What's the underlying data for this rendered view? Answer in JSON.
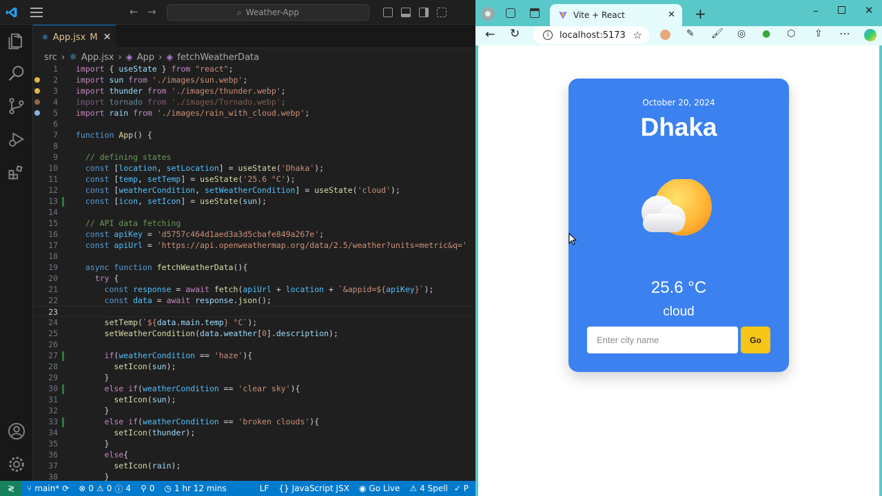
{
  "vscode": {
    "search": "Weather-App",
    "tab": {
      "name": "App.jsx",
      "modified": "M"
    },
    "breadcrumb": [
      "src",
      "App.jsx",
      "App",
      "fetchWeatherData"
    ],
    "lines": [
      {
        "n": "1",
        "t": [
          [
            "kw2",
            "import"
          ],
          [
            "op",
            " { "
          ],
          [
            "var",
            "useState"
          ],
          [
            "op",
            " } "
          ],
          [
            "kw2",
            "from"
          ],
          [
            "str",
            " \"react\""
          ],
          [
            "op",
            ";"
          ]
        ]
      },
      {
        "n": "2",
        "t": [
          [
            "kw2",
            "import"
          ],
          [
            "var",
            " sun "
          ],
          [
            "kw2",
            "from"
          ],
          [
            "str",
            " './images/sun.webp'"
          ],
          [
            "op",
            ";"
          ]
        ]
      },
      {
        "n": "3",
        "t": [
          [
            "kw2",
            "import"
          ],
          [
            "var",
            " thunder "
          ],
          [
            "kw2",
            "from"
          ],
          [
            "str",
            " './images/thunder.webp'"
          ],
          [
            "op",
            ";"
          ]
        ]
      },
      {
        "n": "4",
        "dim": true,
        "t": [
          [
            "kw2",
            "import"
          ],
          [
            "var",
            " tornado "
          ],
          [
            "kw2",
            "from"
          ],
          [
            "str",
            " './images/Tornado.webp'"
          ],
          [
            "op",
            ";"
          ]
        ]
      },
      {
        "n": "5",
        "t": [
          [
            "kw2",
            "import"
          ],
          [
            "var",
            " rain "
          ],
          [
            "kw2",
            "from"
          ],
          [
            "str",
            " './images/rain_with_cloud.webp'"
          ],
          [
            "op",
            ";"
          ]
        ]
      },
      {
        "n": "6",
        "t": []
      },
      {
        "n": "7",
        "t": [
          [
            "kw",
            "function"
          ],
          [
            "fn",
            " App"
          ],
          [
            "op",
            "() {"
          ]
        ]
      },
      {
        "n": "8",
        "t": []
      },
      {
        "n": "9",
        "t": [
          [
            "cm",
            "  // defining states"
          ]
        ]
      },
      {
        "n": "10",
        "t": [
          [
            "kw",
            "  const"
          ],
          [
            "op",
            " ["
          ],
          [
            "cn",
            "location"
          ],
          [
            "op",
            ", "
          ],
          [
            "cn",
            "setLocation"
          ],
          [
            "op",
            "] = "
          ],
          [
            "fn",
            "useState"
          ],
          [
            "op",
            "("
          ],
          [
            "str",
            "'Dhaka'"
          ],
          [
            "op",
            ");"
          ]
        ]
      },
      {
        "n": "11",
        "t": [
          [
            "kw",
            "  const"
          ],
          [
            "op",
            " ["
          ],
          [
            "cn",
            "temp"
          ],
          [
            "op",
            ", "
          ],
          [
            "cn",
            "setTemp"
          ],
          [
            "op",
            "] = "
          ],
          [
            "fn",
            "useState"
          ],
          [
            "op",
            "("
          ],
          [
            "str",
            "'25.6 °C'"
          ],
          [
            "op",
            ");"
          ]
        ]
      },
      {
        "n": "12",
        "t": [
          [
            "kw",
            "  const"
          ],
          [
            "op",
            " ["
          ],
          [
            "cn",
            "weatherCondition"
          ],
          [
            "op",
            ", "
          ],
          [
            "cn",
            "setWeatherCondition"
          ],
          [
            "op",
            "] = "
          ],
          [
            "fn",
            "useState"
          ],
          [
            "op",
            "("
          ],
          [
            "str",
            "'cloud'"
          ],
          [
            "op",
            ");"
          ]
        ]
      },
      {
        "n": "13",
        "t": [
          [
            "kw",
            "  const"
          ],
          [
            "op",
            " ["
          ],
          [
            "cn",
            "icon"
          ],
          [
            "op",
            ", "
          ],
          [
            "cn",
            "setIcon"
          ],
          [
            "op",
            "] = "
          ],
          [
            "fn",
            "useState"
          ],
          [
            "op",
            "("
          ],
          [
            "var",
            "sun"
          ],
          [
            "op",
            ");"
          ]
        ]
      },
      {
        "n": "14",
        "t": []
      },
      {
        "n": "15",
        "t": [
          [
            "cm",
            "  // API data fetching"
          ]
        ]
      },
      {
        "n": "16",
        "t": [
          [
            "kw",
            "  const"
          ],
          [
            "cn",
            " apiKey"
          ],
          [
            "op",
            " = "
          ],
          [
            "str",
            "'d5757c464d1aed3a3d5cbafe849a267e'"
          ],
          [
            "op",
            ";"
          ]
        ]
      },
      {
        "n": "17",
        "t": [
          [
            "kw",
            "  const"
          ],
          [
            "cn",
            " apiUrl"
          ],
          [
            "op",
            " = "
          ],
          [
            "str",
            "'https://api.openweathermap.org/data/2.5/weather?units=metric&q='"
          ]
        ]
      },
      {
        "n": "18",
        "t": []
      },
      {
        "n": "19",
        "t": [
          [
            "kw",
            "  async function"
          ],
          [
            "fn",
            " fetchWeatherData"
          ],
          [
            "op",
            "(){"
          ]
        ]
      },
      {
        "n": "20",
        "t": [
          [
            "kw2",
            "    try"
          ],
          [
            "op",
            " {"
          ]
        ]
      },
      {
        "n": "21",
        "t": [
          [
            "kw",
            "      const"
          ],
          [
            "cn",
            " response"
          ],
          [
            "op",
            " = "
          ],
          [
            "kw2",
            "await"
          ],
          [
            "fn",
            " fetch"
          ],
          [
            "op",
            "("
          ],
          [
            "cn",
            "apiUrl"
          ],
          [
            "op",
            " + "
          ],
          [
            "cn",
            "location"
          ],
          [
            "op",
            " + "
          ],
          [
            "str",
            "`&appid=${"
          ],
          [
            "cn",
            "apiKey"
          ],
          [
            "str",
            "}`"
          ],
          [
            "op",
            ");"
          ]
        ]
      },
      {
        "n": "22",
        "t": [
          [
            "kw",
            "      const"
          ],
          [
            "cn",
            " data"
          ],
          [
            "op",
            " = "
          ],
          [
            "kw2",
            "await"
          ],
          [
            "var",
            " response"
          ],
          [
            "op",
            "."
          ],
          [
            "fn",
            "json"
          ],
          [
            "op",
            "();"
          ]
        ]
      },
      {
        "n": "23",
        "t": []
      },
      {
        "n": "24",
        "t": [
          [
            "fn",
            "      setTemp"
          ],
          [
            "op",
            "("
          ],
          [
            "str",
            "`${"
          ],
          [
            "var",
            "data"
          ],
          [
            "op",
            "."
          ],
          [
            "var",
            "main"
          ],
          [
            "op",
            "."
          ],
          [
            "var",
            "temp"
          ],
          [
            "str",
            "} °C`"
          ],
          [
            "op",
            ");"
          ]
        ]
      },
      {
        "n": "25",
        "t": [
          [
            "fn",
            "      setWeatherCondition"
          ],
          [
            "op",
            "("
          ],
          [
            "var",
            "data"
          ],
          [
            "op",
            "."
          ],
          [
            "var",
            "weather"
          ],
          [
            "op",
            "["
          ],
          [
            "str",
            "0"
          ],
          [
            "op",
            "]."
          ],
          [
            "var",
            "description"
          ],
          [
            "op",
            ");"
          ]
        ]
      },
      {
        "n": "26",
        "t": []
      },
      {
        "n": "27",
        "t": [
          [
            "kw2",
            "      if"
          ],
          [
            "op",
            "("
          ],
          [
            "cn",
            "weatherCondition"
          ],
          [
            "op",
            " == "
          ],
          [
            "str",
            "'haze'"
          ],
          [
            "op",
            "){"
          ]
        ]
      },
      {
        "n": "28",
        "t": [
          [
            "fn",
            "        setIcon"
          ],
          [
            "op",
            "("
          ],
          [
            "var",
            "sun"
          ],
          [
            "op",
            ");"
          ]
        ]
      },
      {
        "n": "29",
        "t": [
          [
            "op",
            "      }"
          ]
        ]
      },
      {
        "n": "30",
        "t": [
          [
            "kw2",
            "      else if"
          ],
          [
            "op",
            "("
          ],
          [
            "cn",
            "weatherCondition"
          ],
          [
            "op",
            " == "
          ],
          [
            "str",
            "'clear sky'"
          ],
          [
            "op",
            "){"
          ]
        ]
      },
      {
        "n": "31",
        "t": [
          [
            "fn",
            "        setIcon"
          ],
          [
            "op",
            "("
          ],
          [
            "var",
            "sun"
          ],
          [
            "op",
            ");"
          ]
        ]
      },
      {
        "n": "32",
        "t": [
          [
            "op",
            "      }"
          ]
        ]
      },
      {
        "n": "33",
        "t": [
          [
            "kw2",
            "      else if"
          ],
          [
            "op",
            "("
          ],
          [
            "cn",
            "weatherCondition"
          ],
          [
            "op",
            " == "
          ],
          [
            "str",
            "'broken clouds'"
          ],
          [
            "op",
            "){"
          ]
        ]
      },
      {
        "n": "34",
        "t": [
          [
            "fn",
            "        setIcon"
          ],
          [
            "op",
            "("
          ],
          [
            "var",
            "thunder"
          ],
          [
            "op",
            ");"
          ]
        ]
      },
      {
        "n": "35",
        "t": [
          [
            "op",
            "      }"
          ]
        ]
      },
      {
        "n": "36",
        "t": [
          [
            "kw2",
            "      else"
          ],
          [
            "op",
            "{"
          ]
        ]
      },
      {
        "n": "37",
        "t": [
          [
            "fn",
            "        setIcon"
          ],
          [
            "op",
            "("
          ],
          [
            "var",
            "rain"
          ],
          [
            "op",
            ");"
          ]
        ]
      },
      {
        "n": "38",
        "t": [
          [
            "op",
            "      }"
          ]
        ]
      }
    ],
    "status": {
      "branch": "main*",
      "errors": "0",
      "warnings": "0",
      "info": "4",
      "ports": "0",
      "time": "1 hr 12 mins",
      "eol": "LF",
      "language": "JavaScript JSX",
      "golive": "Go Live",
      "spell": "4 Spell",
      "extra": "✓ P"
    }
  },
  "browser": {
    "tab_title": "Vite + React",
    "url": "localhost:5173",
    "app": {
      "date": "October 20, 2024",
      "city": "Dhaka",
      "temp": "25.6 °C",
      "condition": "cloud",
      "input_placeholder": "Enter city name",
      "go_label": "Go"
    }
  },
  "colors": {
    "vscode_bg": "#1f1f1f",
    "statusbar": "#007acc",
    "card": "#3b82f0",
    "go_button": "#f5c518",
    "browser_frame": "#5ac8c8"
  }
}
